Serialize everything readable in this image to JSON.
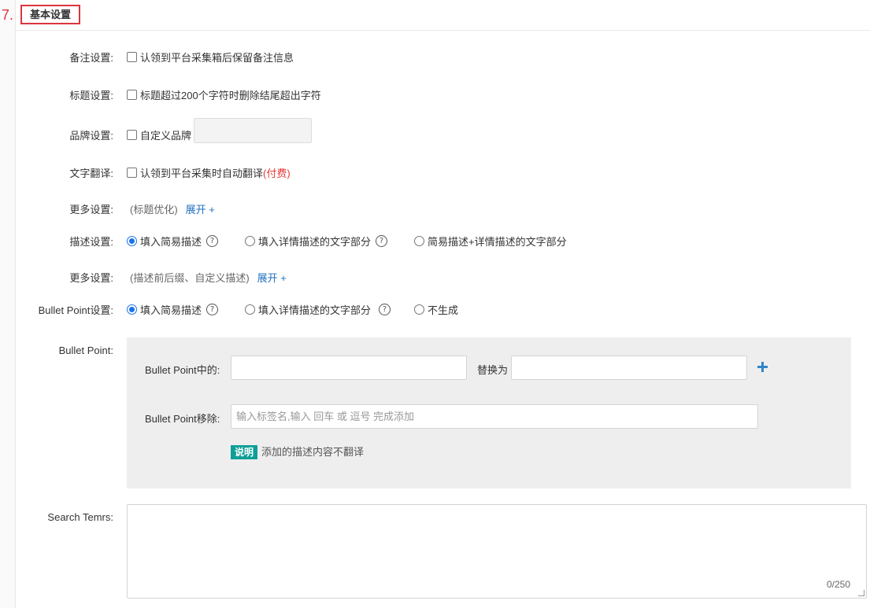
{
  "section": {
    "number": "7.",
    "title": "基本设置"
  },
  "remark": {
    "label": "备注设置:",
    "option": "认领到平台采集箱后保留备注信息"
  },
  "title_setting": {
    "label": "标题设置:",
    "option": "标题超过200个字符时删除结尾超出字符"
  },
  "brand": {
    "label": "品牌设置:",
    "option": "自定义品牌",
    "value": ""
  },
  "translate": {
    "label": "文字翻译:",
    "option": "认领到平台采集时自动翻译",
    "paid": "(付费)"
  },
  "more1": {
    "label": "更多设置:",
    "hint": "(标题优化)",
    "expand": "展开 +"
  },
  "description": {
    "label": "描述设置:",
    "options": [
      "填入简易描述",
      "填入详情描述的文字部分",
      "简易描述+详情描述的文字部分"
    ],
    "selected": 0
  },
  "more2": {
    "label": "更多设置:",
    "hint": "(描述前后缀、自定义描述)",
    "expand": "展开 +"
  },
  "bullet_setting": {
    "label": "Bullet Point设置:",
    "options": [
      "填入简易描述",
      "填入详情描述的文字部分",
      "不生成"
    ],
    "selected": 0
  },
  "bullet_point": {
    "label": "Bullet Point:",
    "replace_label": "Bullet Point中的:",
    "replace_from": "",
    "replace_to_label": "替换为",
    "replace_to": "",
    "add_icon": "plus-icon",
    "remove_label": "Bullet Point移除:",
    "remove_placeholder": "输入标签名,输入 回车 或 逗号 完成添加",
    "note_tag": "说明",
    "note_text": "添加的描述内容不翻译"
  },
  "search_terms": {
    "label": "Search Temrs:",
    "value": "",
    "counter": "0/250"
  },
  "colors": {
    "accent": "#1a73e8",
    "link": "#1f6fbf",
    "danger": "#d9363e",
    "note": "#0e9e97",
    "panel": "#eeeeee"
  },
  "help_icon": "?"
}
